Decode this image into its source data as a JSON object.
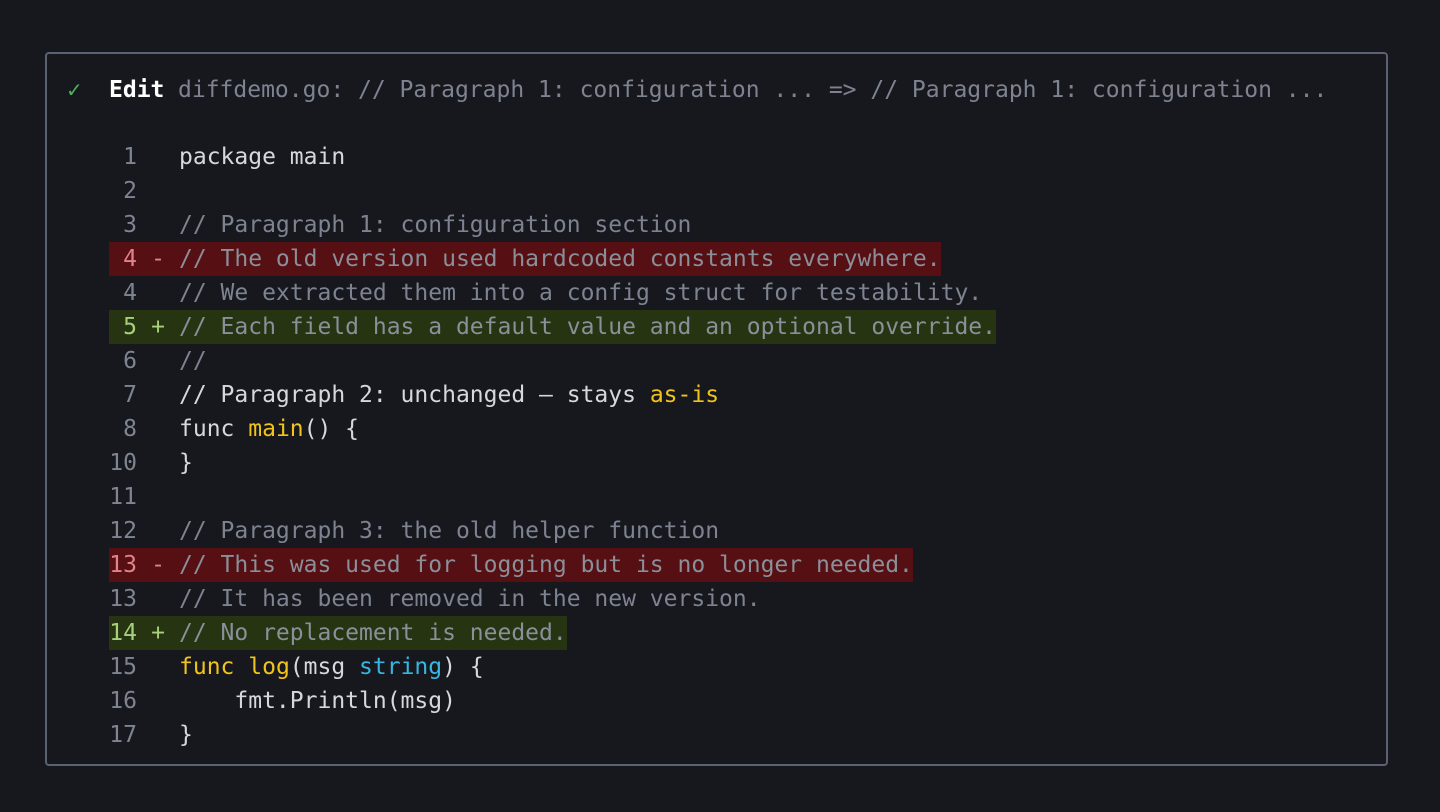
{
  "header": {
    "status_icon": "check-icon",
    "status_glyph": "✓",
    "tool": "Edit",
    "description": "diffdemo.go: // Paragraph 1: configuration ... => // Paragraph 1: configuration ..."
  },
  "colors": {
    "background": "#16181d",
    "border": "#5a6172",
    "removed_bg": "#560f12",
    "added_bg": "#273411",
    "keyword_yellow": "#f2c31b",
    "type_blue": "#36b6e0",
    "success_green": "#4fb05a"
  },
  "lines": [
    {
      "num": "1",
      "marker": "",
      "type": "context",
      "style": "plain",
      "text": "package main"
    },
    {
      "num": "2",
      "marker": "",
      "type": "context",
      "style": "plain",
      "text": ""
    },
    {
      "num": "3",
      "marker": "",
      "type": "context",
      "style": "comment",
      "text": "// Paragraph 1: configuration section"
    },
    {
      "num": "4",
      "marker": "-",
      "type": "removed",
      "style": "comment",
      "text": "// The old version used hardcoded constants everywhere."
    },
    {
      "num": "4",
      "marker": "",
      "type": "context",
      "style": "comment",
      "text": "// We extracted them into a config struct for testability."
    },
    {
      "num": "5",
      "marker": "+",
      "type": "added",
      "style": "comment",
      "text": "// Each field has a default value and an optional override."
    },
    {
      "num": "6",
      "marker": "",
      "type": "context",
      "style": "comment",
      "text": "//"
    },
    {
      "num": "7",
      "marker": "",
      "type": "context",
      "style": "plain",
      "text": "// Paragraph 2: unchanged — stays as-is",
      "segments": [
        {
          "t": "// Paragraph 2: unchanged — stays ",
          "c": "plain"
        },
        {
          "t": "as-is",
          "c": "tok-yellow"
        }
      ]
    },
    {
      "num": "8",
      "marker": "",
      "type": "context",
      "style": "plain",
      "text": "func main() {",
      "segments": [
        {
          "t": "func ",
          "c": "plain"
        },
        {
          "t": "main",
          "c": "tok-yellow"
        },
        {
          "t": "() {",
          "c": "plain"
        }
      ]
    },
    {
      "num": "10",
      "marker": "",
      "type": "context",
      "style": "plain",
      "text": "}"
    },
    {
      "num": "11",
      "marker": "",
      "type": "context",
      "style": "plain",
      "text": ""
    },
    {
      "num": "12",
      "marker": "",
      "type": "context",
      "style": "comment",
      "text": "// Paragraph 3: the old helper function"
    },
    {
      "num": "13",
      "marker": "-",
      "type": "removed",
      "style": "comment",
      "text": "// This was used for logging but is no longer needed."
    },
    {
      "num": "13",
      "marker": "",
      "type": "context",
      "style": "comment",
      "text": "// It has been removed in the new version."
    },
    {
      "num": "14",
      "marker": "+",
      "type": "added",
      "style": "comment",
      "text": "// No replacement is needed."
    },
    {
      "num": "15",
      "marker": "",
      "type": "context",
      "style": "plain",
      "text": "func log(msg string) {",
      "segments": [
        {
          "t": "func ",
          "c": "tok-yellow"
        },
        {
          "t": "log",
          "c": "tok-yellow"
        },
        {
          "t": "(msg ",
          "c": "plain"
        },
        {
          "t": "string",
          "c": "tok-blue"
        },
        {
          "t": ") {",
          "c": "plain"
        }
      ]
    },
    {
      "num": "16",
      "marker": "",
      "type": "context",
      "style": "plain",
      "text": "    fmt.Println(msg)"
    },
    {
      "num": "17",
      "marker": "",
      "type": "context",
      "style": "plain",
      "text": "}"
    }
  ]
}
